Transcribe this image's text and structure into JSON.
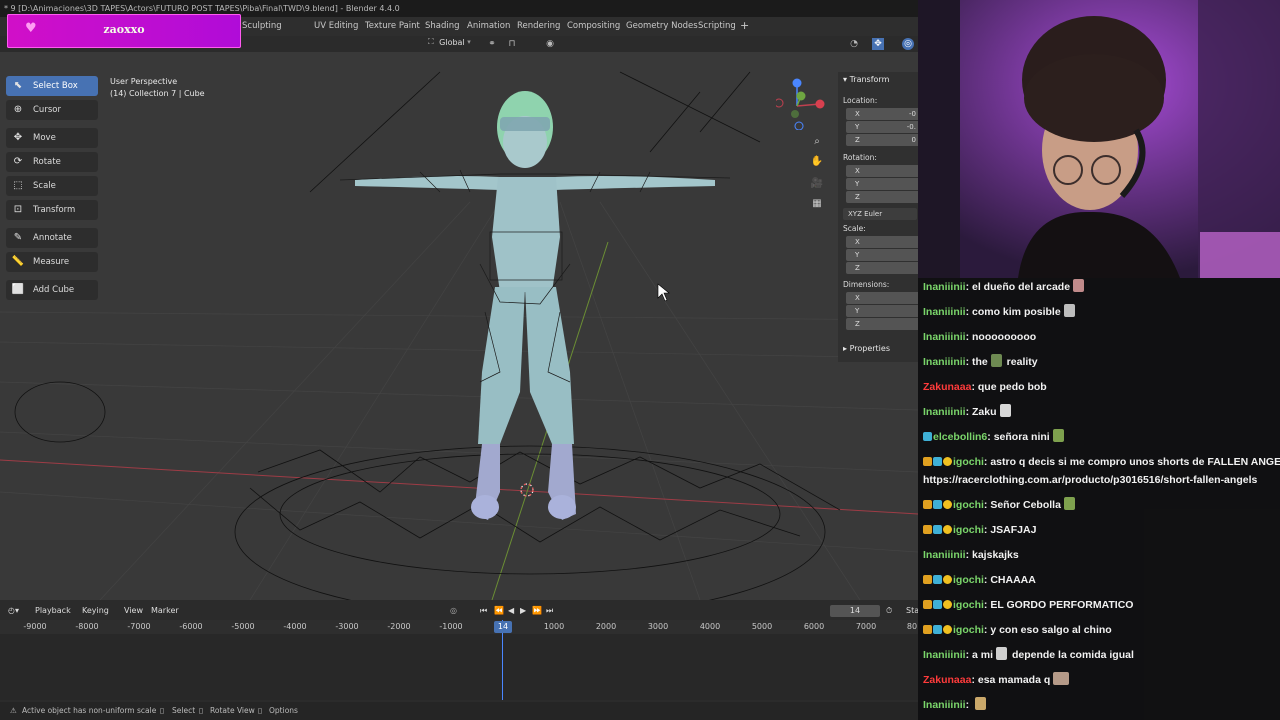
{
  "blender": {
    "title": "* 9 [D:\\Animaciones\\3D TAPES\\Actors\\FUTURO POST TAPES\\Piba\\Final\\TWD\\9.blend] - Blender 4.4.0",
    "workspace_tabs": [
      "Sculpting",
      "UV Editing",
      "Texture Paint",
      "Shading",
      "Animation",
      "Rendering",
      "Compositing",
      "Geometry Nodes",
      "Scripting"
    ],
    "workspace_add": "+",
    "header": {
      "orientation": "Global"
    },
    "viewport": {
      "perspective": "User Perspective",
      "collection": "(14) Collection 7 | Cube"
    },
    "toolbar": [
      {
        "label": "Select Box",
        "icon": "select-box-icon",
        "active": true
      },
      {
        "label": "Cursor",
        "icon": "cursor-icon"
      },
      {
        "label": "Move",
        "icon": "move-icon"
      },
      {
        "label": "Rotate",
        "icon": "rotate-icon"
      },
      {
        "label": "Scale",
        "icon": "scale-icon"
      },
      {
        "label": "Transform",
        "icon": "transform-icon"
      },
      {
        "label": "Annotate",
        "icon": "annotate-icon"
      },
      {
        "label": "Measure",
        "icon": "measure-icon"
      },
      {
        "label": "Add Cube",
        "icon": "add-cube-icon"
      }
    ],
    "npanel": {
      "transform": "Transform",
      "location": "Location:",
      "loc_values": [
        "-0",
        "-0.",
        "0"
      ],
      "rotation": "Rotation:",
      "rot_mode": "XYZ Euler",
      "scale": "Scale:",
      "dimensions": "Dimensions:",
      "properties": "Properties",
      "axes": [
        "X",
        "Y",
        "Z"
      ]
    },
    "timeline": {
      "menus": [
        "Playback",
        "Keying",
        "View",
        "Marker"
      ],
      "ticks": [
        "-9000",
        "-8000",
        "-7000",
        "-6000",
        "-5000",
        "-4000",
        "-3000",
        "-2000",
        "-1000",
        "1000",
        "2000",
        "3000",
        "4000",
        "5000",
        "6000",
        "7000",
        "80"
      ],
      "current_frame": "14",
      "frame_field": "14",
      "start_label": "Sta"
    },
    "statusbar": {
      "message": "Active object has non-uniform scale",
      "select": "Select",
      "rotate_view": "Rotate View",
      "options": "Options"
    },
    "colors": {
      "accent": "#4772b3",
      "x_axis": "#c0404f",
      "y_axis": "#6ea641",
      "z_axis": "#4a86ff"
    }
  },
  "stream": {
    "streamer_name": "zaoxxo",
    "badge_color": "#c910d2"
  },
  "chat": [
    {
      "user": "Inaniiinii",
      "color": "#7bd66b",
      "text": ": el dueño del arcade",
      "emote": true
    },
    {
      "user": "Inaniiinii",
      "color": "#7bd66b",
      "text": ": como kim posible",
      "emote": true
    },
    {
      "user": "Inaniiinii",
      "color": "#7bd66b",
      "text": ": nooooooooo"
    },
    {
      "user": "Inaniiinii",
      "color": "#7bd66b",
      "text": ": the",
      "emote_mid": true,
      "text2": " reality"
    },
    {
      "user": "Zakunaaa",
      "color": "#ff3b3b",
      "text": ": que pedo bob"
    },
    {
      "user": "Inaniiinii",
      "color": "#7bd66b",
      "text": ": Zaku",
      "emote": true
    },
    {
      "user": "elcebollin6",
      "color": "#7bd66b",
      "text": ": señora nini",
      "emote": true,
      "badges": 1
    },
    {
      "user": "igochi",
      "color": "#7bd66b",
      "text": ": astro q decis si me compro unos shorts de FALLEN ANGEL",
      "emote": true,
      "badges": 3,
      "cont": "https://racerclothing.com.ar/producto/p3016516/short-fallen-angels"
    },
    {
      "user": "igochi",
      "color": "#7bd66b",
      "text": ": Señor Cebolla",
      "emote": true,
      "badges": 3
    },
    {
      "user": "igochi",
      "color": "#7bd66b",
      "text": ": JSAFJAJ",
      "badges": 3
    },
    {
      "user": "Inaniiinii",
      "color": "#7bd66b",
      "text": ": kajskajks"
    },
    {
      "user": "igochi",
      "color": "#7bd66b",
      "text": ": CHAAAA",
      "badges": 3
    },
    {
      "user": "igochi",
      "color": "#7bd66b",
      "text": ": EL GORDO PERFORMATICO",
      "badges": 3
    },
    {
      "user": "igochi",
      "color": "#7bd66b",
      "text": ": y con eso salgo al chino",
      "badges": 3
    },
    {
      "user": "Inaniiinii",
      "color": "#7bd66b",
      "text": ": a mi",
      "emote_mid": true,
      "text2": " depende la comida igual"
    },
    {
      "user": "Zakunaaa",
      "color": "#ff3b3b",
      "text": ": esa mamada q",
      "emote": true
    },
    {
      "user": "Inaniiinii",
      "color": "#7bd66b",
      "text": ": ",
      "emote": true
    }
  ]
}
